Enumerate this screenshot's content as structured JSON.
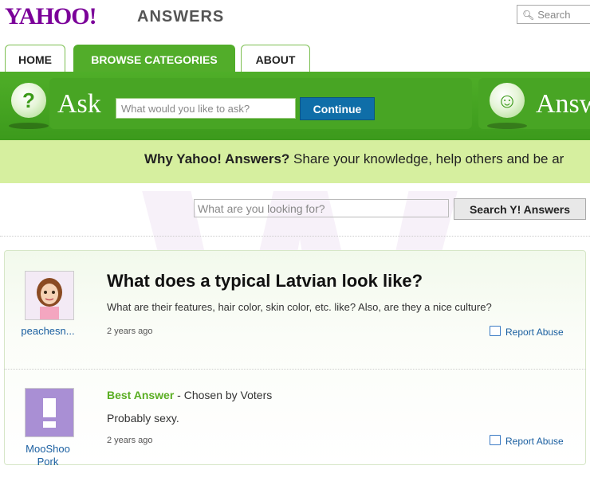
{
  "brand": {
    "logo_text": "YAHOO!",
    "section_text": "ANSWERS"
  },
  "top_search": {
    "placeholder": "Search",
    "icon": "search-icon"
  },
  "tabs": [
    {
      "label": "HOME",
      "active": false
    },
    {
      "label": "BROWSE CATEGORIES",
      "active": true
    },
    {
      "label": "ABOUT",
      "active": false
    }
  ],
  "ask": {
    "label": "Ask",
    "placeholder": "What would you like to ask?",
    "button": "Continue",
    "icon": "question-bubble-icon"
  },
  "answer": {
    "label": "Answ",
    "icon": "smiley-bubble-icon"
  },
  "why": {
    "strong": "Why Yahoo! Answers?",
    "text": " Share your knowledge, help others and be ar"
  },
  "question_search": {
    "placeholder": "What are you looking for?",
    "button": "Search Y! Answers"
  },
  "question": {
    "user": "peachesn...",
    "title": "What does a typical Latvian look like?",
    "body": "What are their features, hair color, skin color, etc. like? Also, are they a nice culture?",
    "time": "2 years ago",
    "report": "Report Abuse"
  },
  "best_answer": {
    "label": "Best Answer",
    "chosen": " - Chosen by Voters",
    "user": "MooShoo",
    "user_line2": "Pork",
    "text": "Probably sexy.",
    "time": "2 years ago",
    "report": "Report Abuse"
  },
  "colors": {
    "brand_purple": "#7b0099",
    "green": "#52ad2a",
    "light_green": "#d6ef9f",
    "link_blue": "#1a5fa0",
    "button_blue": "#0f6ea8"
  }
}
